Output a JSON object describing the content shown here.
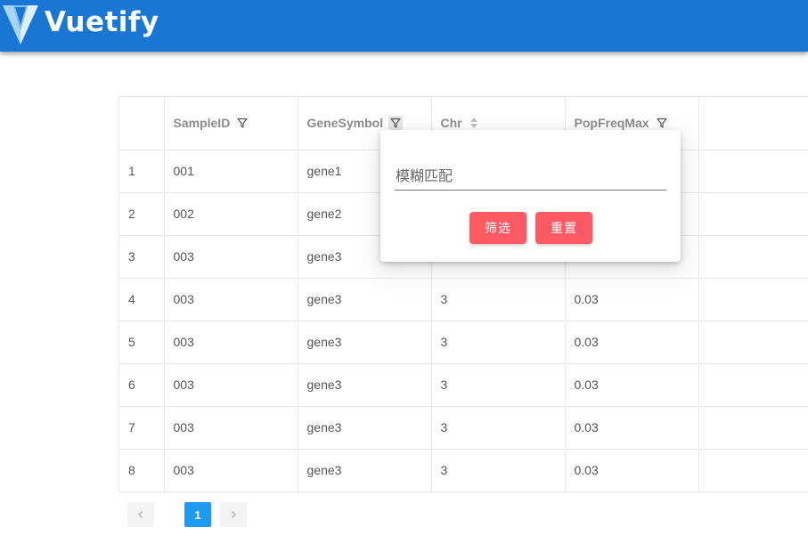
{
  "appbar": {
    "brand": "Vuetify",
    "logo_icon": "vuetify-logo-icon",
    "colors": {
      "bar": "#1976d2",
      "logo_light": "#a8d4f5",
      "logo_dark": "#dff0fc"
    }
  },
  "table": {
    "columns": [
      {
        "label": "",
        "icon": null
      },
      {
        "label": "SampleID",
        "icon": "filter-icon"
      },
      {
        "label": "GeneSymbol",
        "icon": "filter-icon"
      },
      {
        "label": "Chr",
        "icon": "sort-icon"
      },
      {
        "label": "PopFreqMax",
        "icon": "filter-icon"
      },
      {
        "label": "",
        "icon": null
      }
    ],
    "rows": [
      {
        "idx": "1",
        "sample": "001",
        "gene": "gene1",
        "chr": "",
        "freq": ""
      },
      {
        "idx": "2",
        "sample": "002",
        "gene": "gene2",
        "chr": "",
        "freq": ""
      },
      {
        "idx": "3",
        "sample": "003",
        "gene": "gene3",
        "chr": "",
        "freq": ""
      },
      {
        "idx": "4",
        "sample": "003",
        "gene": "gene3",
        "chr": "3",
        "freq": "0.03"
      },
      {
        "idx": "5",
        "sample": "003",
        "gene": "gene3",
        "chr": "3",
        "freq": "0.03"
      },
      {
        "idx": "6",
        "sample": "003",
        "gene": "gene3",
        "chr": "3",
        "freq": "0.03"
      },
      {
        "idx": "7",
        "sample": "003",
        "gene": "gene3",
        "chr": "3",
        "freq": "0.03"
      },
      {
        "idx": "8",
        "sample": "003",
        "gene": "gene3",
        "chr": "3",
        "freq": "0.03"
      }
    ]
  },
  "filter_popover": {
    "input_placeholder": "模糊匹配",
    "input_value": "",
    "filter_button": "筛选",
    "reset_button": "重置",
    "button_color": "#ff5a64"
  },
  "pagination": {
    "current_page": "1",
    "prev_icon": "chevron-left-icon",
    "next_icon": "chevron-right-icon",
    "active_color": "#1e9bf0"
  }
}
